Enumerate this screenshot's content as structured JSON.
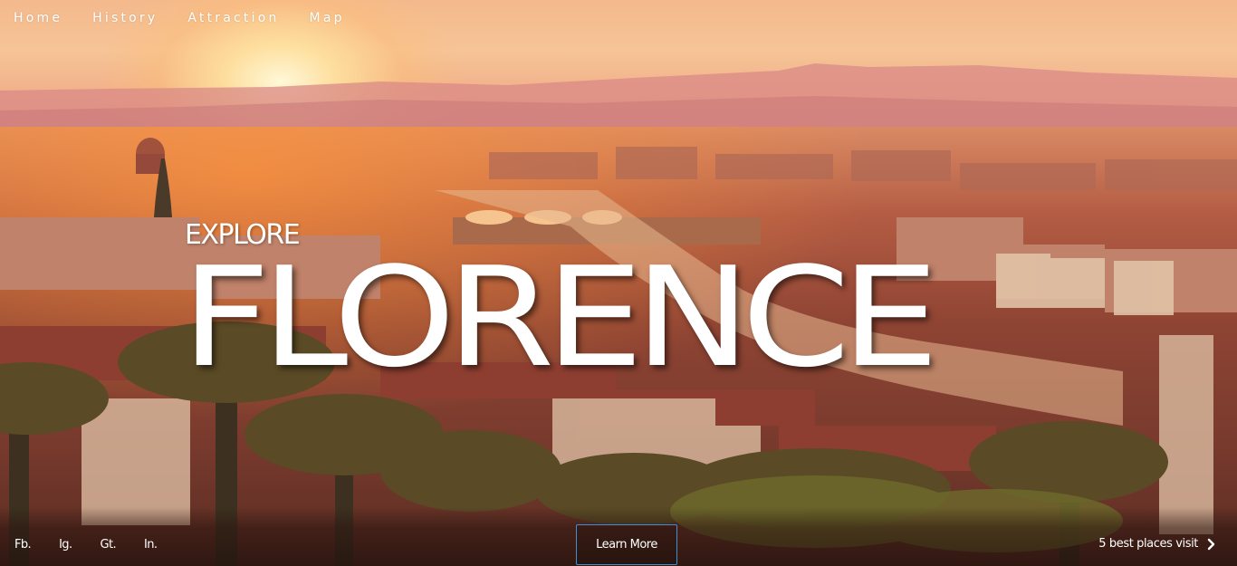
{
  "nav": {
    "items": [
      {
        "label": "Home"
      },
      {
        "label": "History"
      },
      {
        "label": "Attraction"
      },
      {
        "label": "Map"
      }
    ]
  },
  "hero": {
    "subtitle": "EXPLORE",
    "title": "FLORENCE"
  },
  "footer": {
    "social": [
      {
        "label": "Fb."
      },
      {
        "label": "Ig."
      },
      {
        "label": "Gt."
      },
      {
        "label": "In."
      }
    ],
    "cta_label": "Learn More",
    "next_label": "5 best places visit",
    "next_icon": "chevron-right-icon"
  },
  "colors": {
    "text": "#ffffff",
    "button_border": "#3d8fd6"
  }
}
